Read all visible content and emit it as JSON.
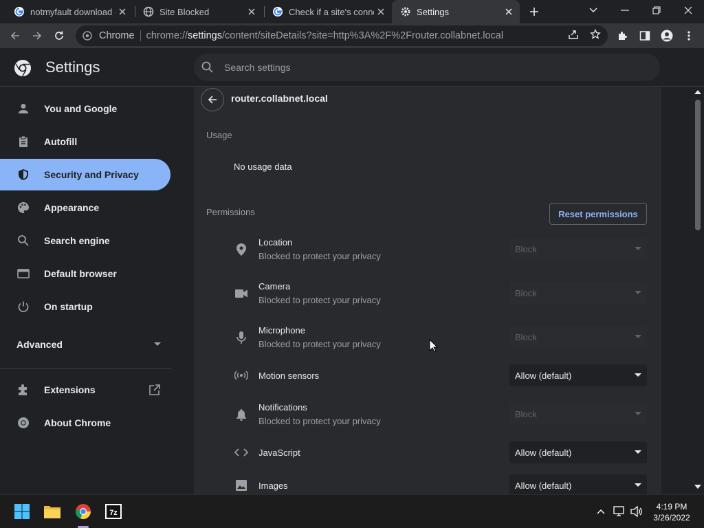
{
  "tabs": [
    {
      "title": "notmyfault download -",
      "favicon": "google-icon",
      "active": false
    },
    {
      "title": "Site Blocked",
      "favicon": "globe-icon",
      "active": false
    },
    {
      "title": "Check if a site's connec",
      "favicon": "google-icon",
      "active": false
    },
    {
      "title": "Settings",
      "favicon": "gear-icon",
      "active": true
    }
  ],
  "omnibox": {
    "chip": "Chrome",
    "url_scheme": "chrome://",
    "url_host": "settings",
    "url_rest": "/content/siteDetails?site=http%3A%2F%2Frouter.collabnet.local"
  },
  "header": {
    "title": "Settings",
    "search_placeholder": "Search settings"
  },
  "sidebar": {
    "items": [
      {
        "label": "You and Google",
        "icon": "person-icon"
      },
      {
        "label": "Autofill",
        "icon": "clipboard-icon"
      },
      {
        "label": "Security and Privacy",
        "icon": "shield-icon",
        "active": true
      },
      {
        "label": "Appearance",
        "icon": "palette-icon"
      },
      {
        "label": "Search engine",
        "icon": "search-icon"
      },
      {
        "label": "Default browser",
        "icon": "browser-icon"
      },
      {
        "label": "On startup",
        "icon": "power-icon"
      }
    ],
    "advanced": "Advanced",
    "extensions": "Extensions",
    "about": "About Chrome"
  },
  "site": {
    "title": "router.collabnet.local",
    "usage_label": "Usage",
    "usage_text": "No usage data",
    "permissions_label": "Permissions",
    "reset_button": "Reset permissions"
  },
  "permissions": [
    {
      "name": "Location",
      "sub": "Blocked to protect your privacy",
      "value": "Block",
      "enabled": false,
      "icon": "location-pin-icon"
    },
    {
      "name": "Camera",
      "sub": "Blocked to protect your privacy",
      "value": "Block",
      "enabled": false,
      "icon": "camera-icon"
    },
    {
      "name": "Microphone",
      "sub": "Blocked to protect your privacy",
      "value": "Block",
      "enabled": false,
      "icon": "microphone-icon"
    },
    {
      "name": "Motion sensors",
      "sub": "",
      "value": "Allow (default)",
      "enabled": true,
      "icon": "sensors-icon"
    },
    {
      "name": "Notifications",
      "sub": "Blocked to protect your privacy",
      "value": "Block",
      "enabled": false,
      "icon": "bell-icon"
    },
    {
      "name": "JavaScript",
      "sub": "",
      "value": "Allow (default)",
      "enabled": true,
      "icon": "code-icon"
    },
    {
      "name": "Images",
      "sub": "",
      "value": "Allow (default)",
      "enabled": true,
      "icon": "image-icon"
    }
  ],
  "clock": {
    "time": "4:19 PM",
    "date": "3/26/2022"
  },
  "colors": {
    "accent": "#8ab4f8",
    "background": "#202124",
    "surface": "#292a2d"
  }
}
